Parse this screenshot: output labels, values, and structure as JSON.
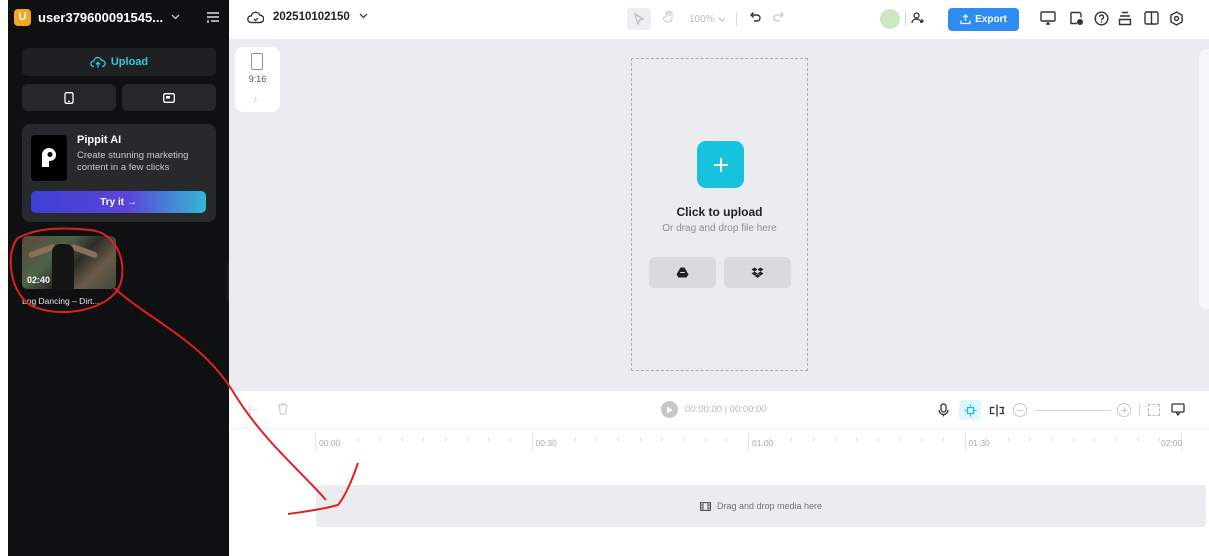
{
  "sidebar": {
    "user_initial": "U",
    "username": "user379600091545...",
    "upload_label": "Upload",
    "promo": {
      "title": "Pippit AI",
      "description": "Create stunning marketing content in a few clicks",
      "cta": "Try it →"
    },
    "media": [
      {
        "duration": "02:40",
        "title": "Log Dancing – Dirt..."
      }
    ]
  },
  "topbar": {
    "project_name": "202510102150",
    "zoom": "100%",
    "export_label": "Export"
  },
  "canvas": {
    "ratio_label": "9:16",
    "upload_title": "Click to upload",
    "upload_subtitle": "Or drag and drop file here"
  },
  "timeline": {
    "time_display": "00:00:00 | 00:00:00",
    "ruler_labels": [
      "00:00",
      "00:30",
      "01:00",
      "01:30",
      "02:00"
    ],
    "drop_label": "Drag and drop media here"
  },
  "colors": {
    "sidebar_bg": "#0f1012",
    "accent_cyan": "#17c3dc",
    "export_blue": "#2e8cf0",
    "annotation_red": "#e0201c"
  },
  "icons": [
    "menu-icon",
    "cloud-upload-icon",
    "phone-icon",
    "desktop-icon",
    "cloud-save-icon",
    "select-tool-icon",
    "hand-tool-icon",
    "undo-icon",
    "redo-icon",
    "add-user-icon",
    "export-icon",
    "google-drive-icon",
    "dropbox-icon",
    "microphone-icon",
    "magnet-icon",
    "split-icon",
    "caption-icon"
  ]
}
